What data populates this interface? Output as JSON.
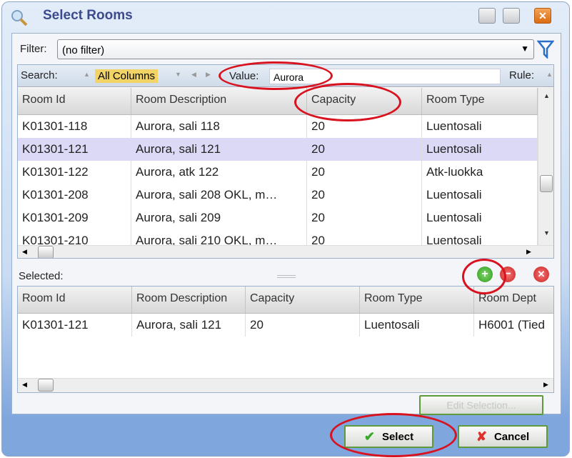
{
  "window": {
    "title": "Select Rooms",
    "icon": "magnifier-icon"
  },
  "filter": {
    "label": "Filter:",
    "value": "(no filter)"
  },
  "search": {
    "label": "Search:",
    "column": "All Columns",
    "value_label": "Value:",
    "value": "Aurora",
    "rule_label": "Rule:"
  },
  "rooms_grid": {
    "columns": [
      "Room Id",
      "Room Description",
      "Capacity",
      "Room Type"
    ],
    "rows": [
      [
        "K01301-118",
        "Aurora, sali 118",
        "20",
        "Luentosali"
      ],
      [
        "K01301-121",
        "Aurora, sali 121",
        "20",
        "Luentosali"
      ],
      [
        "K01301-122",
        "Aurora, atk 122",
        "20",
        "Atk-luokka"
      ],
      [
        "K01301-208",
        "Aurora, sali 208 OKL, m…",
        "20",
        "Luentosali"
      ],
      [
        "K01301-209",
        "Aurora, sali 209",
        "20",
        "Luentosali"
      ],
      [
        "K01301-210",
        "Aurora, sali 210 OKL, m…",
        "20",
        "Luentosali"
      ]
    ],
    "selected_row": 1
  },
  "selected": {
    "label": "Selected:",
    "columns": [
      "Room Id",
      "Room Description",
      "Capacity",
      "Room Type",
      "Room Dept"
    ],
    "rows": [
      [
        "K01301-121",
        "Aurora, sali 121",
        "20",
        "Luentosali",
        "H6001 (Tied"
      ]
    ]
  },
  "buttons": {
    "edit_selection": "Edit Selection...",
    "select": "Select",
    "cancel": "Cancel"
  },
  "colors": {
    "accent": "#3c4a8e",
    "highlight": "#dcd9f6",
    "annotation": "#d8121e"
  }
}
